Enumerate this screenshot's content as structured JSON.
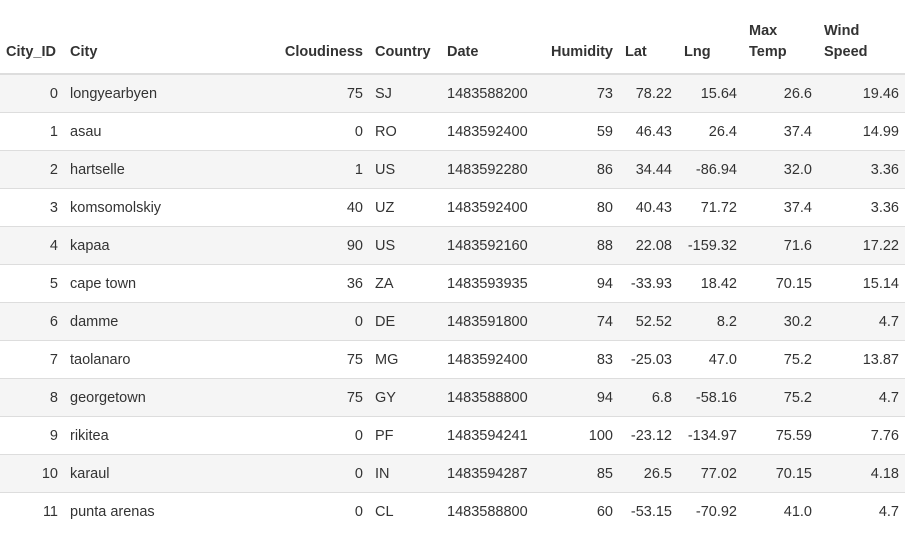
{
  "table": {
    "columns": [
      {
        "key": "City_ID",
        "label": "City_ID",
        "align": "right"
      },
      {
        "key": "City",
        "label": "City",
        "align": "left"
      },
      {
        "key": "Cloudiness",
        "label": "Cloudiness",
        "align": "right"
      },
      {
        "key": "Country",
        "label": "Country",
        "align": "left"
      },
      {
        "key": "Date",
        "label": "Date",
        "align": "left"
      },
      {
        "key": "Humidity",
        "label": "Humidity",
        "align": "right"
      },
      {
        "key": "Lat",
        "label": "Lat",
        "align": "left"
      },
      {
        "key": "Lng",
        "label": "Lng",
        "align": "left"
      },
      {
        "key": "Max_Temp",
        "label": "Max Temp",
        "align": "left"
      },
      {
        "key": "Wind_Speed",
        "label": "Wind Speed",
        "align": "left"
      }
    ],
    "rows": [
      [
        "0",
        "longyearbyen",
        "75",
        "SJ",
        "1483588200",
        "73",
        "78.22",
        "15.64",
        "26.6",
        "19.46"
      ],
      [
        "1",
        "asau",
        "0",
        "RO",
        "1483592400",
        "59",
        "46.43",
        "26.4",
        "37.4",
        "14.99"
      ],
      [
        "2",
        "hartselle",
        "1",
        "US",
        "1483592280",
        "86",
        "34.44",
        "-86.94",
        "32.0",
        "3.36"
      ],
      [
        "3",
        "komsomolskiy",
        "40",
        "UZ",
        "1483592400",
        "80",
        "40.43",
        "71.72",
        "37.4",
        "3.36"
      ],
      [
        "4",
        "kapaa",
        "90",
        "US",
        "1483592160",
        "88",
        "22.08",
        "-159.32",
        "71.6",
        "17.22"
      ],
      [
        "5",
        "cape town",
        "36",
        "ZA",
        "1483593935",
        "94",
        "-33.93",
        "18.42",
        "70.15",
        "15.14"
      ],
      [
        "6",
        "damme",
        "0",
        "DE",
        "1483591800",
        "74",
        "52.52",
        "8.2",
        "30.2",
        "4.7"
      ],
      [
        "7",
        "taolanaro",
        "75",
        "MG",
        "1483592400",
        "83",
        "-25.03",
        "47.0",
        "75.2",
        "13.87"
      ],
      [
        "8",
        "georgetown",
        "75",
        "GY",
        "1483588800",
        "94",
        "6.8",
        "-58.16",
        "75.2",
        "4.7"
      ],
      [
        "9",
        "rikitea",
        "0",
        "PF",
        "1483594241",
        "100",
        "-23.12",
        "-134.97",
        "75.59",
        "7.76"
      ],
      [
        "10",
        "karaul",
        "0",
        "IN",
        "1483594287",
        "85",
        "26.5",
        "77.02",
        "70.15",
        "4.18"
      ],
      [
        "11",
        "punta arenas",
        "0",
        "CL",
        "1483588800",
        "60",
        "-53.15",
        "-70.92",
        "41.0",
        "4.7"
      ]
    ]
  }
}
